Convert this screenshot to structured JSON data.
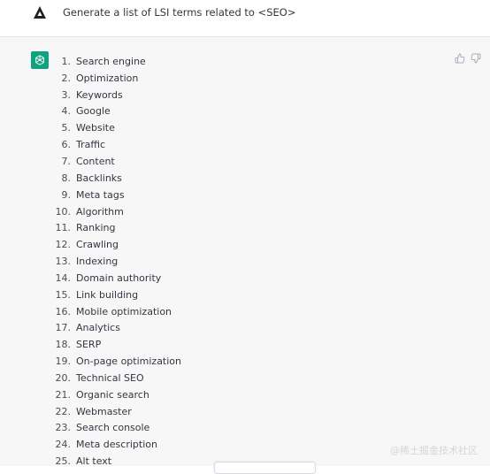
{
  "prompt": {
    "text": "Generate a list of LSI terms related to <SEO>",
    "avatar_icon": "user-avatar-triangle-icon"
  },
  "response": {
    "avatar_icon": "openai-logo-icon",
    "accent_color": "#10a37f",
    "items": [
      {
        "num": "1.",
        "label": "Search engine"
      },
      {
        "num": "2.",
        "label": "Optimization"
      },
      {
        "num": "3.",
        "label": "Keywords"
      },
      {
        "num": "4.",
        "label": "Google"
      },
      {
        "num": "5.",
        "label": "Website"
      },
      {
        "num": "6.",
        "label": "Traffic"
      },
      {
        "num": "7.",
        "label": "Content"
      },
      {
        "num": "8.",
        "label": "Backlinks"
      },
      {
        "num": "9.",
        "label": "Meta tags"
      },
      {
        "num": "10.",
        "label": "Algorithm"
      },
      {
        "num": "11.",
        "label": "Ranking"
      },
      {
        "num": "12.",
        "label": "Crawling"
      },
      {
        "num": "13.",
        "label": "Indexing"
      },
      {
        "num": "14.",
        "label": "Domain authority"
      },
      {
        "num": "15.",
        "label": "Link building"
      },
      {
        "num": "16.",
        "label": "Mobile optimization"
      },
      {
        "num": "17.",
        "label": "Analytics"
      },
      {
        "num": "18.",
        "label": "SERP"
      },
      {
        "num": "19.",
        "label": "On-page optimization"
      },
      {
        "num": "20.",
        "label": "Technical SEO"
      },
      {
        "num": "21.",
        "label": "Organic search"
      },
      {
        "num": "22.",
        "label": "Webmaster"
      },
      {
        "num": "23.",
        "label": "Search console"
      },
      {
        "num": "24.",
        "label": "Meta description"
      },
      {
        "num": "25.",
        "label": "Alt text"
      }
    ],
    "feedback": {
      "thumbs_up_icon": "thumbs-up-icon",
      "thumbs_down_icon": "thumbs-down-icon"
    }
  },
  "watermark": "@稀土掘金技术社区"
}
